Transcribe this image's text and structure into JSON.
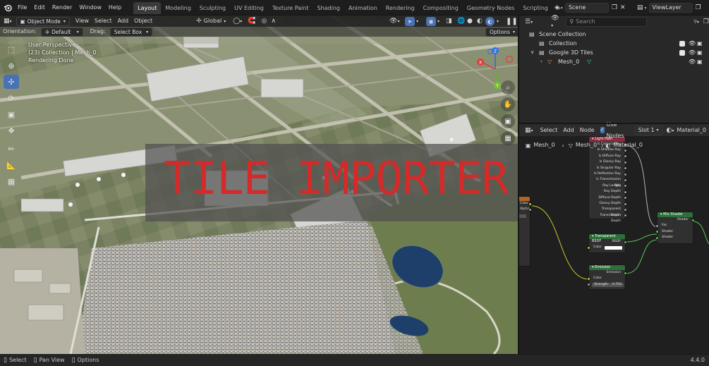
{
  "menu": {
    "items": [
      "File",
      "Edit",
      "Render",
      "Window",
      "Help"
    ]
  },
  "workspaces": {
    "tabs": [
      "Layout",
      "Modeling",
      "Sculpting",
      "UV Editing",
      "Texture Paint",
      "Shading",
      "Animation",
      "Rendering",
      "Compositing",
      "Geometry Nodes",
      "Scripting"
    ],
    "active": "Layout",
    "add_symbol": "+"
  },
  "scene": {
    "label": "Scene",
    "view_layer": "ViewLayer"
  },
  "viewport": {
    "mode": "Object Mode",
    "menus": [
      "View",
      "Select",
      "Add",
      "Object"
    ],
    "transform_orientation": "Global",
    "orientation_label": "Orientation:",
    "orientation_value": "Default",
    "drag_label": "Drag:",
    "drag_value": "Select Box",
    "options_label": "Options",
    "overlay_lines": [
      "User Perspective",
      "(23) Collection | Mesh_0",
      "Rendering Done"
    ],
    "watermark": "TILE IMPORTER",
    "axis_labels": {
      "x": "X",
      "y": "Y",
      "z": "Z"
    }
  },
  "outliner": {
    "search_placeholder": "Search",
    "rows": [
      {
        "label": "Scene Collection",
        "indent": 0
      },
      {
        "label": "Collection",
        "indent": 1
      },
      {
        "label": "Google 3D Tiles",
        "indent": 1
      },
      {
        "label": "Mesh_0",
        "indent": 2
      }
    ]
  },
  "node_editor": {
    "menus": [
      "Select",
      "Add",
      "Node"
    ],
    "use_nodes_label": "Use Nodes",
    "slot": "Slot 1",
    "material": "Material_0",
    "breadcrumb": [
      "Mesh_0",
      "Mesh_0",
      "Material_0"
    ],
    "light_path": {
      "title": "Light Path",
      "outputs": [
        "Is Camera Ray",
        "Is Shadow Ray",
        "Is Diffuse Ray",
        "Is Glossy Ray",
        "Is Singular Ray",
        "Is Reflection Ray",
        "Is Transmission Ray",
        "Ray Length",
        "Ray Depth",
        "Diffuse Depth",
        "Glossy Depth",
        "Transparent Depth",
        "Transmission Depth"
      ]
    },
    "mix_shader": {
      "title": "Mix Shader",
      "output": "Shader",
      "inputs": [
        "Fac",
        "Shader",
        "Shader"
      ]
    },
    "transparent_bsdf": {
      "title": "Transparent BSDF",
      "output": "BSDF",
      "input": "Color"
    },
    "emission": {
      "title": "Emission",
      "output": "Emission",
      "inputs": [
        "Color"
      ],
      "strength_label": "Strength",
      "strength_value": "0.750"
    },
    "image_texture": {
      "outputs": [
        "Color",
        "Alpha"
      ]
    }
  },
  "statusbar": {
    "items": [
      "Select",
      "Pan View",
      "Options"
    ],
    "version": "4.4.0"
  },
  "colors": {
    "accent": "#4772b3",
    "watermark": "#d42a2a",
    "node_light_path": "#8c2b3e",
    "node_shader": "#2d6e3a",
    "node_texture": "#b5641f"
  }
}
